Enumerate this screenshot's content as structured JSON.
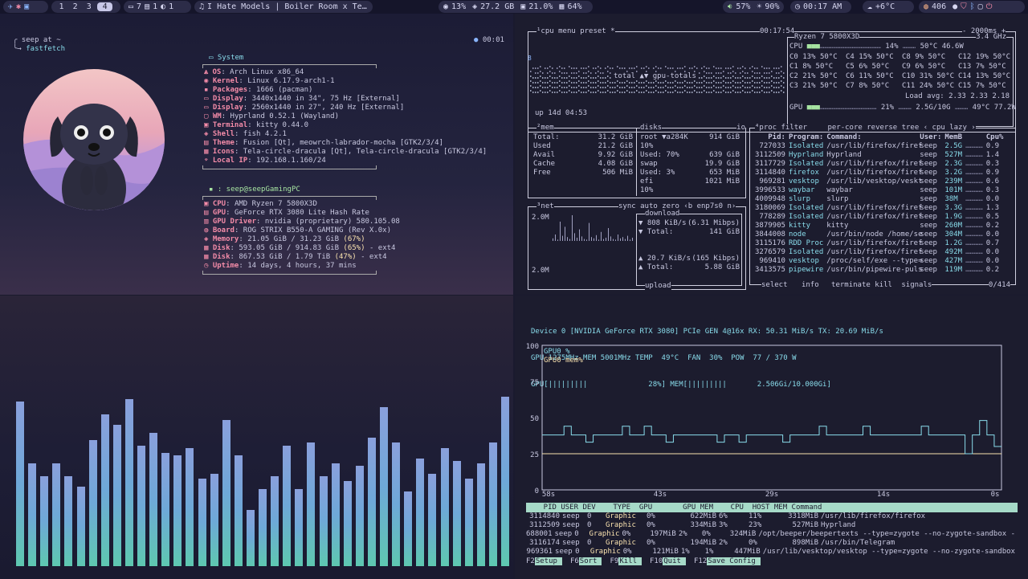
{
  "topbar": {
    "workspaces": [
      "1",
      "2",
      "3",
      "4"
    ],
    "active_workspace": "4",
    "windows": {
      "terminals": "7",
      "files": "1",
      "other": "1"
    },
    "now_playing": "I Hate Models | Boiler Room x Te…",
    "cpu_usage": "13%",
    "mem_used": "27.2 GB",
    "gpu_usage": "21.0%",
    "disk_usage": "64%",
    "volume": "57%",
    "brightness": "90%",
    "clock": "00:17 AM",
    "weather": "+6°C",
    "updates": "406"
  },
  "fastfetch": {
    "prompt_user": "seep at ~",
    "prompt_cmd": "fastfetch",
    "timer": "00:01",
    "system_title": "System",
    "system": [
      {
        "k": "OS",
        "v": ": Arch Linux x86_64"
      },
      {
        "k": "Kernel",
        "v": ": Linux 6.17.9-arch1-1"
      },
      {
        "k": "Packages",
        "v": ": 1666 (pacman)"
      },
      {
        "k": "Display",
        "v": ": 3440x1440 in 34\", 75 Hz [External]"
      },
      {
        "k": "Display",
        "v": ": 2560x1440 in 27\", 240 Hz [External]"
      },
      {
        "k": "WM",
        "v": ": Hyprland 0.52.1 (Wayland)"
      },
      {
        "k": "Terminal",
        "v": ": kitty 0.44.0"
      },
      {
        "k": "Shell",
        "v": ": fish 4.2.1"
      },
      {
        "k": "Theme",
        "v": ": Fusion [Qt], meowrch-labrador-mocha [GTK2/3/4]"
      },
      {
        "k": "Icons",
        "v": ": Tela-circle-dracula [Qt], Tela-circle-dracula [GTK2/3/4]"
      },
      {
        "k": "Local IP",
        "v": ": 192.168.1.160/24"
      }
    ],
    "host_title": ": seep@seepGamingPC",
    "hardware": [
      {
        "k": "CPU",
        "v": ": AMD Ryzen 7 5800X3D",
        "p": ""
      },
      {
        "k": "GPU",
        "v": ": GeForce RTX 3080 Lite Hash Rate",
        "p": ""
      },
      {
        "k": "GPU Driver",
        "v": ": nvidia (proprietary) 580.105.08",
        "p": ""
      },
      {
        "k": "Board",
        "v": ": ROG STRIX B550-A GAMING (Rev X.0x)",
        "p": ""
      },
      {
        "k": "Memory",
        "v": ": 21.05 GiB / 31.23 GiB",
        "p": "(67%)",
        "s": ""
      },
      {
        "k": "Disk",
        "v": ": 593.05 GiB / 914.83 GiB",
        "p": "(65%)",
        "s": "- ext4"
      },
      {
        "k": "Disk",
        "v": ": 867.53 GiB / 1.79 TiB",
        "p": "(47%)",
        "s": "- ext4"
      },
      {
        "k": "Uptime",
        "v": ": 14 days, 4 hours, 37 mins",
        "p": ""
      }
    ]
  },
  "visualizer": {
    "levels": [
      0.64,
      0.4,
      0.35,
      0.4,
      0.35,
      0.31,
      0.49,
      0.59,
      0.55,
      0.65,
      0.47,
      0.52,
      0.44,
      0.43,
      0.46,
      0.34,
      0.36,
      0.57,
      0.43,
      0.22,
      0.3,
      0.35,
      0.47,
      0.3,
      0.48,
      0.35,
      0.4,
      0.33,
      0.39,
      0.5,
      0.62,
      0.48,
      0.29,
      0.42,
      0.36,
      0.46,
      0.41,
      0.34,
      0.4,
      0.48,
      0.66
    ]
  },
  "btop": {
    "cpu_tab": "¹cpu",
    "menu_tab": "menu",
    "preset_tab": "preset *",
    "clock": "00:17:54",
    "interval": "- 2000ms +",
    "cpu_model": "Ryzen 7 5800X3D",
    "cpu_freq": "3.4 GHz",
    "cpu_total": {
      "label": "CPU",
      "pct": "14%",
      "temp": "50°C",
      "watts": "46.6W"
    },
    "cores": [
      [
        "C0",
        "13%",
        "50°C",
        "C4",
        "15%",
        "50°C",
        "C8",
        "9%",
        "50°C",
        "C12",
        "19%",
        "50°C"
      ],
      [
        "C1",
        "8%",
        "50°C",
        "C5",
        "6%",
        "50°C",
        "C9",
        "6%",
        "50°C",
        "C13",
        "7%",
        "50°C"
      ],
      [
        "C2",
        "21%",
        "50°C",
        "C6",
        "11%",
        "50°C",
        "C10",
        "31%",
        "50°C",
        "C14",
        "13%",
        "50°C"
      ],
      [
        "C3",
        "21%",
        "50°C",
        "C7",
        "8%",
        "50°C",
        "C11",
        "24%",
        "50°C",
        "C15",
        "7%",
        "50°C"
      ]
    ],
    "load_avg": "Load avg: 2.33 2.33 2.18",
    "gpu_line": {
      "label": "GPU",
      "pct": "21%",
      "mem": "2.5G/10G",
      "temp": "49°C",
      "watts": "77.2W"
    },
    "graph_label": "total ▲▼ gpu-totals",
    "uptime": "up 14d 04:53",
    "graph_top": "8",
    "mem": {
      "title": "²mem",
      "rows": [
        {
          "k": "Total:",
          "v": "31.2 GiB"
        },
        {
          "k": "Used",
          "v": "21.2 GiB"
        },
        {
          "k": "Avail",
          "v": "9.92 GiB"
        },
        {
          "k": "Cache",
          "v": "4.08 GiB"
        },
        {
          "k": "Free",
          "v": "506 MiB"
        }
      ]
    },
    "disks": {
      "title": "disks",
      "io": "io",
      "rows": [
        {
          "a": "root",
          "b": "▼a284K",
          "c": "914 GiB"
        },
        {
          "a": "10%",
          "b": "",
          "c": ""
        },
        {
          "a": "Used: 70%",
          "b": "",
          "c": "639 GiB"
        },
        {
          "a": "swap",
          "b": "",
          "c": "19.9 GiB"
        },
        {
          "a": "Used: 3%",
          "b": "",
          "c": "653 MiB"
        },
        {
          "a": "efi",
          "b": "",
          "c": "1021 MiB"
        },
        {
          "a": "10%",
          "b": "",
          "c": ""
        }
      ]
    },
    "net": {
      "title": "³net",
      "tabs": [
        "sync",
        "auto",
        "zero",
        "‹b enp7s0 n›"
      ],
      "scale_top": "2.0M",
      "scale_bottom": "2.0M",
      "download_label": "download",
      "down_rate": "▼ 808 KiB/s",
      "down_bits": "(6.31 Mibps)",
      "down_total_k": "▼ Total:",
      "down_total": "141 GiB",
      "up_rate": "▲ 20.7 KiB/s",
      "up_bits": "(165 Kibps)",
      "up_total_k": "▲ Total:",
      "up_total": "5.88 GiB",
      "upload_label": "upload"
    },
    "proc": {
      "title": "⁴proc",
      "tabs": [
        "filter",
        "per-core",
        "reverse",
        "tree",
        "‹ cpu lazy ›"
      ],
      "headers": [
        "Pid:",
        "Program:",
        "Command:",
        "User:",
        "MemB",
        "",
        "Cpu%"
      ],
      "rows": [
        [
          "727033",
          "Isolated",
          "/usr/lib/firefox/firef",
          "seep",
          "2.5G",
          "0.9"
        ],
        [
          "3112509",
          "Hyprland",
          "Hyprland",
          "seep",
          "527M",
          "1.4"
        ],
        [
          "3117729",
          "Isolated",
          "/usr/lib/firefox/firef",
          "seep",
          "2.3G",
          "0.3"
        ],
        [
          "3114840",
          "firefox",
          "/usr/lib/firefox/firef",
          "seep",
          "3.2G",
          "0.9"
        ],
        [
          "969281",
          "vesktop",
          "/usr/lib/vesktop/veskt",
          "seep",
          "239M",
          "0.6"
        ],
        [
          "3996533",
          "waybar",
          "waybar",
          "seep",
          "101M",
          "0.3"
        ],
        [
          "4009948",
          "slurp",
          "slurp",
          "seep",
          "38M",
          "0.0"
        ],
        [
          "3180069",
          "Isolated",
          "/usr/lib/firefox/firef",
          "seep",
          "3.3G",
          "1.3"
        ],
        [
          "778289",
          "Isolated",
          "/usr/lib/firefox/firef",
          "seep",
          "1.9G",
          "0.5"
        ],
        [
          "3879905",
          "kitty",
          "kitty",
          "seep",
          "260M",
          "0.2"
        ],
        [
          "3844008",
          "node",
          "/usr/bin/node /home/se",
          "seep",
          "304M",
          "0.0"
        ],
        [
          "3115176",
          "RDD Proc",
          "/usr/lib/firefox/firef",
          "seep",
          "1.2G",
          "0.7"
        ],
        [
          "3276579",
          "Isolated",
          "/usr/lib/firefox/firef",
          "seep",
          "492M",
          "0.0"
        ],
        [
          "969410",
          "vesktop",
          "/proc/self/exe --type=",
          "seep",
          "427M",
          "0.0"
        ],
        [
          "3413575",
          "pipewire",
          "/usr/bin/pipewire-puls",
          "seep",
          "119M",
          "0.2"
        ]
      ],
      "footer": [
        "select",
        "info",
        "terminate",
        "kill",
        "signals"
      ],
      "count": "0/414"
    }
  },
  "nvtop": {
    "device_line": "Device 0 [NVIDIA GeForce RTX 3080] PCIe GEN 4@16x RX: 50.31 MiB/s TX: 20.69 MiB/s",
    "clock_line": "GPU 1275MHz MEM 5001MHz TEMP  49°C  FAN  30%  POW  77 / 370 W",
    "util_line": "GPU[|||||||||              28%] MEM[|||||||||       2.506Gi/10.000Gi]",
    "y_ticks": [
      "100",
      "75",
      "50",
      "25",
      "0"
    ],
    "x_ticks": [
      "58s",
      "43s",
      "29s",
      "14s",
      "0s"
    ],
    "legend": [
      "GPU0 %",
      "GPU0 mem%"
    ],
    "series_gpu": [
      38,
      38,
      38,
      44,
      38,
      38,
      33,
      38,
      38,
      38,
      38,
      44,
      38,
      38,
      44,
      38,
      38,
      33,
      38,
      38,
      38,
      38,
      38,
      38,
      33,
      38,
      38,
      33,
      38,
      38,
      38,
      38,
      38,
      33,
      38,
      38,
      38,
      38,
      44,
      38,
      38,
      38,
      38,
      38,
      44,
      38,
      38,
      38,
      38,
      38,
      38,
      38,
      44,
      38,
      38,
      38,
      38,
      38,
      25,
      38,
      48,
      38,
      30
    ],
    "series_mem": [
      25,
      25,
      25,
      25,
      25,
      25,
      25,
      25,
      25,
      25,
      25,
      25,
      25,
      25,
      25,
      25,
      25,
      25,
      25,
      25,
      25,
      25,
      25,
      25,
      25,
      25,
      25,
      25,
      25,
      25,
      25,
      25,
      25,
      25,
      25,
      25,
      25,
      25,
      25,
      25,
      25,
      25,
      25,
      25,
      25,
      25,
      25,
      25,
      25,
      25,
      25,
      25,
      25,
      25,
      25,
      25,
      25,
      25,
      25,
      25,
      25,
      25,
      25
    ],
    "table_header": "    PID USER DEV    TYPE  GPU       GPU MEM    CPU  HOST MEM Command",
    "rows": [
      [
        "3114840",
        "seep",
        "0",
        "Graphic",
        "0%",
        "622MiB",
        "6%",
        "11%",
        "3318MiB",
        "/usr/lib/firefox/firefox"
      ],
      [
        "3112509",
        "seep",
        "0",
        "Graphic",
        "0%",
        "334MiB",
        "3%",
        "23%",
        "527MiB",
        "Hyprland"
      ],
      [
        "688001",
        "seep",
        "0",
        "Graphic",
        "0%",
        "197MiB",
        "2%",
        "0%",
        "324MiB",
        "/opt/beeper/beepertexts --type=zygote --no-zygote-sandbox -"
      ],
      [
        "3116174",
        "seep",
        "0",
        "Graphic",
        "0%",
        "194MiB",
        "2%",
        "0%",
        "898MiB",
        "/usr/bin/Telegram"
      ],
      [
        "969361",
        "seep",
        "0",
        "Graphic",
        "0%",
        "121MiB",
        "1%",
        "1%",
        "447MiB",
        "/usr/lib/vesktop/vesktop --type=zygote --no-zygote-sandbox"
      ]
    ],
    "fkeys": [
      [
        "F2",
        "Setup"
      ],
      [
        "F6",
        "Sort"
      ],
      [
        "F9",
        "Kill"
      ],
      [
        "F10",
        "Quit"
      ],
      [
        "F12",
        "Save Config"
      ]
    ]
  }
}
